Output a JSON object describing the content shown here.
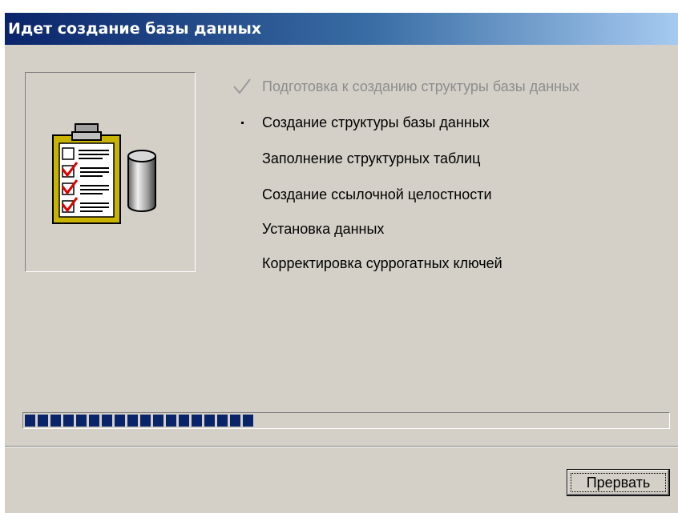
{
  "window": {
    "title": "Идет создание базы данных"
  },
  "illustration": {
    "icons": [
      "clipboard-checklist-icon",
      "database-cylinder-icon"
    ]
  },
  "steps": [
    {
      "label": "Подготовка к созданию структуры базы данных",
      "status": "done",
      "marker": "checkmark-icon"
    },
    {
      "label": "Создание структуры базы данных",
      "status": "current",
      "marker": "bullet-icon"
    },
    {
      "label": "Заполнение структурных таблиц",
      "status": "pending"
    },
    {
      "label": "Создание ссылочной целостности",
      "status": "pending"
    },
    {
      "label": "Установка данных",
      "status": "pending"
    },
    {
      "label": "Корректировка суррогатных ключей",
      "status": "pending"
    }
  ],
  "progress": {
    "fraction": 0.36,
    "color": "#0a246a"
  },
  "buttons": {
    "abort_label": "Прервать"
  },
  "colors": {
    "dialog_bg": "#d4d0c8",
    "title_gradient_start": "#0a246a",
    "title_gradient_end": "#a6caf0",
    "done_text": "#8d8d8d"
  }
}
